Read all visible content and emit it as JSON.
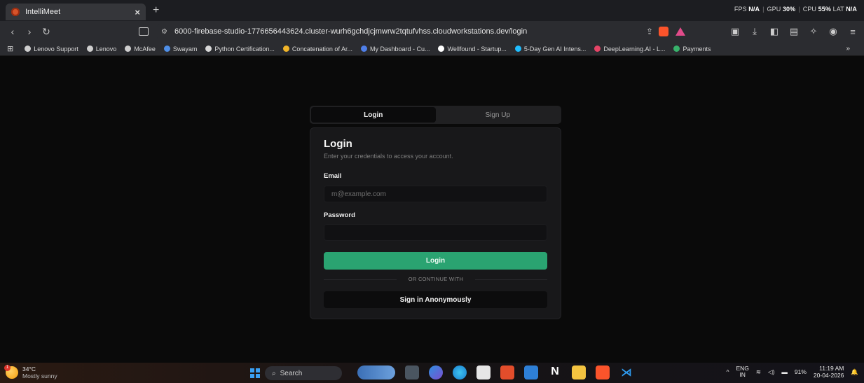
{
  "browser": {
    "tab_title": "IntelliMeet",
    "tab_close": "×",
    "new_tab": "+",
    "perf": {
      "fps_label": "FPS",
      "fps_value": "N/A",
      "gpu_label": "GPU",
      "gpu_value": "30%",
      "cpu_label": "CPU",
      "cpu_value": "55%",
      "lat_label": "LAT",
      "lat_value": "N/A"
    },
    "url": "6000-firebase-studio-1776656443624.cluster-wurh6gchdjcjmwrw2tqtufvhss.cloudworkstations.dev/login",
    "bookmarks": [
      {
        "label": "Lenovo Support",
        "color": "#cfcfcf"
      },
      {
        "label": "Lenovo",
        "color": "#cfcfcf"
      },
      {
        "label": "McAfee",
        "color": "#cfcfcf"
      },
      {
        "label": "Swayam",
        "color": "#4f8fe8"
      },
      {
        "label": "Python Certification...",
        "color": "#d8d8d8"
      },
      {
        "label": "Concatenation of Ar...",
        "color": "#f0b429"
      },
      {
        "label": "My Dashboard - Cu...",
        "color": "#4f7fe8"
      },
      {
        "label": "Wellfound - Startup...",
        "color": "#ffffff"
      },
      {
        "label": "5-Day Gen AI Intens...",
        "color": "#20beff"
      },
      {
        "label": "DeepLearning.AI - L...",
        "color": "#e54466"
      },
      {
        "label": "Payments",
        "color": "#38b26b"
      }
    ],
    "bookmarks_more": "»"
  },
  "auth": {
    "tab_login": "Login",
    "tab_signup": "Sign Up",
    "title": "Login",
    "subtitle": "Enter your credentials to access your account.",
    "email_label": "Email",
    "email_placeholder": "m@example.com",
    "password_label": "Password",
    "password_placeholder": "",
    "login_button": "Login",
    "divider_text": "OR CONTINUE WITH",
    "anon_button": "Sign in Anonymously"
  },
  "taskbar": {
    "weather_temp": "34°C",
    "weather_desc": "Mostly sunny",
    "weather_badge": "1",
    "search_label": "Search",
    "lang_top": "ENG",
    "lang_bottom": "IN",
    "battery": "91%",
    "time": "11:19 AM",
    "date": "20-04-2026"
  },
  "colors": {
    "accent": "#2aa371",
    "card_bg": "#18181a",
    "page_bg": "#0a0a0a"
  }
}
